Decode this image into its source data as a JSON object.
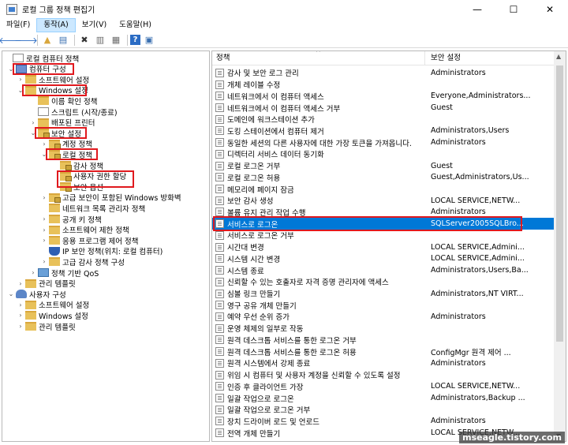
{
  "window": {
    "title": "로컬 그룹 정책 편집기",
    "controls": {
      "minimize": "—",
      "maximize": "☐",
      "close": "✕"
    }
  },
  "menubar": {
    "items": [
      {
        "label": "파일(F)"
      },
      {
        "label": "동작(A)",
        "active": true
      },
      {
        "label": "보기(V)"
      },
      {
        "label": "도움말(H)"
      }
    ]
  },
  "toolbar": {
    "buttons": [
      "back-icon",
      "forward-icon",
      "up-folder-icon",
      "show-hide-tree-icon",
      "delete-icon",
      "properties-icon",
      "export-list-icon",
      "help-icon",
      "console-icon"
    ],
    "glyphs": {
      "back": "🡐",
      "forward": "🡒",
      "up": "▲",
      "tree": "▤",
      "delete": "✖",
      "properties": "▥",
      "export": "▦",
      "help": "?",
      "console": "▣"
    }
  },
  "tree": {
    "items": [
      {
        "label": "로컬 컴퓨터 정책",
        "icon": "doc",
        "level": 0,
        "expander": ""
      },
      {
        "label": "컴퓨터 구성",
        "icon": "pc",
        "level": 1,
        "expander": "⌄"
      },
      {
        "label": "소프트웨어 설정",
        "icon": "folder",
        "level": 2,
        "expander": "›"
      },
      {
        "label": "Windows 설정",
        "icon": "folder",
        "level": 2,
        "expander": "⌄"
      },
      {
        "label": "이름 확인 정책",
        "icon": "folder",
        "level": 3,
        "expander": ""
      },
      {
        "label": "스크립트 (시작/종료)",
        "icon": "doc",
        "level": 3,
        "expander": ""
      },
      {
        "label": "배포된 프린터",
        "icon": "folder",
        "level": 3,
        "expander": "›"
      },
      {
        "label": "보안 설정",
        "icon": "folder-lock",
        "level": 3,
        "expander": "⌄"
      },
      {
        "label": "계정 정책",
        "icon": "folder-lock",
        "level": 4,
        "expander": "›"
      },
      {
        "label": "로컬 정책",
        "icon": "folder-lock",
        "level": 4,
        "expander": "⌄"
      },
      {
        "label": "감사 정책",
        "icon": "folder-lock",
        "level": 5,
        "expander": ""
      },
      {
        "label": "사용자 권한 할당",
        "icon": "folder-lock",
        "level": 5,
        "expander": ""
      },
      {
        "label": "보안 옵션",
        "icon": "folder-lock",
        "level": 5,
        "expander": ""
      },
      {
        "label": "고급 보안이 포함된 Windows 방화벽",
        "icon": "folder-lock",
        "level": 4,
        "expander": "›"
      },
      {
        "label": "네트워크 목록 관리자 정책",
        "icon": "folder",
        "level": 4,
        "expander": ""
      },
      {
        "label": "공개 키 정책",
        "icon": "folder",
        "level": 4,
        "expander": "›"
      },
      {
        "label": "소프트웨어 제한 정책",
        "icon": "folder",
        "level": 4,
        "expander": "›"
      },
      {
        "label": "응용 프로그램 제어 정책",
        "icon": "folder",
        "level": 4,
        "expander": "›"
      },
      {
        "label": "IP 보안 정책(위치: 로컬 컴퓨터)",
        "icon": "shield",
        "level": 4,
        "expander": ""
      },
      {
        "label": "고급 감사 정책 구성",
        "icon": "folder",
        "level": 4,
        "expander": "›"
      },
      {
        "label": "정책 기반 QoS",
        "icon": "chart",
        "level": 3,
        "expander": "›"
      },
      {
        "label": "관리 템플릿",
        "icon": "folder",
        "level": 2,
        "expander": "›"
      },
      {
        "label": "사용자 구성",
        "icon": "user",
        "level": 1,
        "expander": "⌄"
      },
      {
        "label": "소프트웨어 설정",
        "icon": "folder",
        "level": 2,
        "expander": "›"
      },
      {
        "label": "Windows 설정",
        "icon": "folder",
        "level": 2,
        "expander": "›"
      },
      {
        "label": "관리 템플릿",
        "icon": "folder",
        "level": 2,
        "expander": "›"
      }
    ]
  },
  "list": {
    "columns": {
      "policy": "정책",
      "security": "보안 설정",
      "sort_arrow": "^"
    },
    "rows": [
      {
        "policy": "감사 및 보안 로그 관리",
        "security": "Administrators"
      },
      {
        "policy": "개체 레이블 수정",
        "security": ""
      },
      {
        "policy": "네트워크에서 이 컴퓨터 액세스",
        "security": "Everyone,Administrators..."
      },
      {
        "policy": "네트워크에서 이 컴퓨터 액세스 거부",
        "security": "Guest"
      },
      {
        "policy": "도메인에 워크스테이션 추가",
        "security": ""
      },
      {
        "policy": "도킹 스테이션에서 컴퓨터 제거",
        "security": "Administrators,Users"
      },
      {
        "policy": "동일한 세션의 다른 사용자에 대한 가장 토큰을 가져옵니다.",
        "security": "Administrators"
      },
      {
        "policy": "디렉터리 서비스 데이터 동기화",
        "security": ""
      },
      {
        "policy": "로컬 로그온 거부",
        "security": "Guest"
      },
      {
        "policy": "로컬 로그온 허용",
        "security": "Guest,Administrators,Us..."
      },
      {
        "policy": "메모리에 페이지 잠금",
        "security": ""
      },
      {
        "policy": "보안 감사 생성",
        "security": "LOCAL SERVICE,NETW..."
      },
      {
        "policy": "볼륨 유지 관리 작업 수행",
        "security": "Administrators"
      },
      {
        "policy": "서비스로 로그온",
        "security": "SQLServer2005SQLBro...",
        "selected": true
      },
      {
        "policy": "서비스로 로그온 거부",
        "security": ""
      },
      {
        "policy": "시간대 변경",
        "security": "LOCAL SERVICE,Admini..."
      },
      {
        "policy": "시스템 시간 변경",
        "security": "LOCAL SERVICE,Admini..."
      },
      {
        "policy": "시스템 종료",
        "security": "Administrators,Users,Ba..."
      },
      {
        "policy": "신뢰할 수 있는 호출자로 자격 증명 관리자에 액세스",
        "security": ""
      },
      {
        "policy": "심볼 링크 만들기",
        "security": "Administrators,NT VIRT..."
      },
      {
        "policy": "영구 공유 개체 만들기",
        "security": ""
      },
      {
        "policy": "예약 우선 순위 증가",
        "security": "Administrators"
      },
      {
        "policy": "운영 체제의 일부로 작동",
        "security": ""
      },
      {
        "policy": "원격 데스크톱 서비스를 통한 로그온 거부",
        "security": ""
      },
      {
        "policy": "원격 데스크톱 서비스를 통한 로그온 허용",
        "security": "ConfigMgr 원격 제어 ..."
      },
      {
        "policy": "원격 시스템에서 강제 종료",
        "security": "Administrators"
      },
      {
        "policy": "위임 시 컴퓨터 및 사용자 계정을 신뢰할 수 있도록 설정",
        "security": ""
      },
      {
        "policy": "인증 후 클라이언트 가장",
        "security": "LOCAL SERVICE,NETW..."
      },
      {
        "policy": "일괄 작업으로 로그온",
        "security": "Administrators,Backup ..."
      },
      {
        "policy": "일괄 작업으로 로그온 거부",
        "security": ""
      },
      {
        "policy": "장치 드라이버 로드 및 언로드",
        "security": "Administrators"
      },
      {
        "policy": "전역 개체 만들기",
        "security": "LOCAL SERVICE,NETW..."
      }
    ]
  },
  "scrollbar": {
    "up": "▲",
    "down": "▼"
  },
  "watermark": "mseagle.tistory.com",
  "colors": {
    "highlight_box": "#e0191e",
    "selection": "#0078d7"
  }
}
